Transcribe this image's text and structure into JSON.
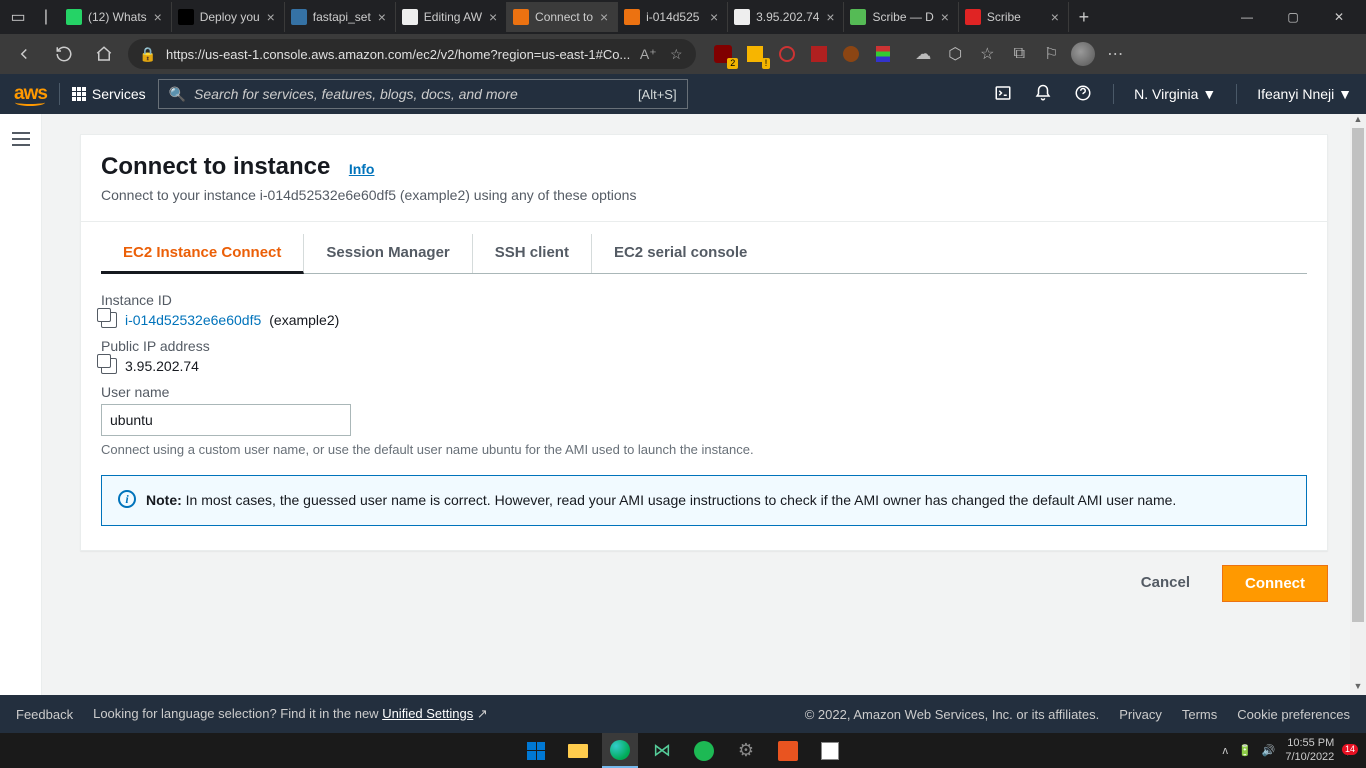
{
  "browser": {
    "tabs": [
      {
        "title": "(12) Whats",
        "favicon_color": "#25d366"
      },
      {
        "title": "Deploy you",
        "favicon_color": "#000"
      },
      {
        "title": "fastapi_set",
        "favicon_color": "#3572A5"
      },
      {
        "title": "Editing AW",
        "favicon_color": "#eee"
      },
      {
        "title": "Connect to",
        "favicon_color": "#ec7211",
        "active": true
      },
      {
        "title": "i-014d525",
        "favicon_color": "#ec7211"
      },
      {
        "title": "3.95.202.74",
        "favicon_color": "#eee"
      },
      {
        "title": "Scribe — D",
        "favicon_color": "#5b5"
      },
      {
        "title": "Scribe",
        "favicon_color": "#e02424"
      }
    ],
    "url": "https://us-east-1.console.aws.amazon.com/ec2/v2/home?region=us-east-1#Co...",
    "reader_label": "A⁺",
    "ublock_badge": "2",
    "other_badge": "!"
  },
  "aws": {
    "services": "Services",
    "search_placeholder": "Search for services, features, blogs, docs, and more",
    "search_kbd": "[Alt+S]",
    "region": "N. Virginia",
    "user": "Ifeanyi Nneji"
  },
  "page": {
    "title": "Connect to instance",
    "info": "Info",
    "subtitle": "Connect to your instance i-014d52532e6e60df5 (example2) using any of these options",
    "tabs": [
      "EC2 Instance Connect",
      "Session Manager",
      "SSH client",
      "EC2 serial console"
    ],
    "fields": {
      "instance_id_label": "Instance ID",
      "instance_id": "i-014d52532e6e60df5",
      "instance_name": "(example2)",
      "public_ip_label": "Public IP address",
      "public_ip": "3.95.202.74",
      "username_label": "User name",
      "username_value": "ubuntu",
      "username_help": "Connect using a custom user name, or use the default user name ubuntu for the AMI used to launch the instance."
    },
    "note": {
      "label": "Note:",
      "text": "In most cases, the guessed user name is correct. However, read your AMI usage instructions to check if the AMI owner has changed the default AMI user name."
    },
    "actions": {
      "cancel": "Cancel",
      "connect": "Connect"
    }
  },
  "footer": {
    "feedback": "Feedback",
    "lang_text": "Looking for language selection? Find it in the new ",
    "unified": "Unified Settings",
    "copyright": "© 2022, Amazon Web Services, Inc. or its affiliates.",
    "privacy": "Privacy",
    "terms": "Terms",
    "cookie": "Cookie preferences"
  },
  "taskbar": {
    "time": "10:55 PM",
    "date": "7/10/2022",
    "notif": "14"
  }
}
